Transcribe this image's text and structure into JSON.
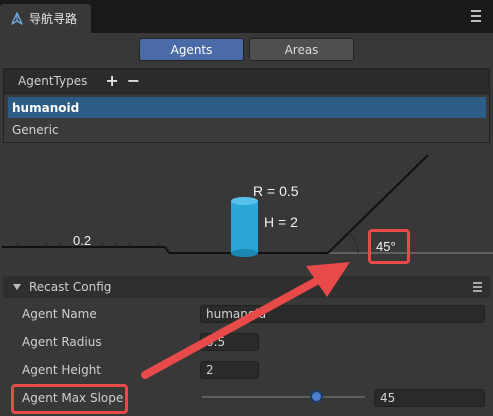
{
  "window": {
    "tab_title": "导航寻路",
    "tab_icon": "navigation-icon"
  },
  "toggle": {
    "agents_label": "Agents",
    "areas_label": "Areas",
    "active": "Agents"
  },
  "agent_types": {
    "header": "AgentTypes",
    "add_label": "+",
    "remove_label": "−",
    "items": [
      {
        "label": "humanoid",
        "selected": true
      },
      {
        "label": "Generic",
        "selected": false
      }
    ]
  },
  "diagram": {
    "step_height_label": "0.2",
    "radius_label": "R = 0.5",
    "height_label": "H = 2",
    "slope_label": "45°"
  },
  "recast_config": {
    "title": "Recast Config",
    "properties": {
      "agent_name": {
        "label": "Agent Name",
        "value": "humanoid"
      },
      "agent_radius": {
        "label": "Agent Radius",
        "value": "0.5"
      },
      "agent_height": {
        "label": "Agent Height",
        "value": "2"
      },
      "agent_max_slope": {
        "label": "Agent Max Slope",
        "value": "45",
        "slider_fraction": 0.7
      }
    }
  },
  "colors": {
    "accent": "#4a6aa8",
    "selection": "#2c5d87",
    "annotation": "#e84a4a",
    "agent_cylinder": "#2aa7d8"
  }
}
